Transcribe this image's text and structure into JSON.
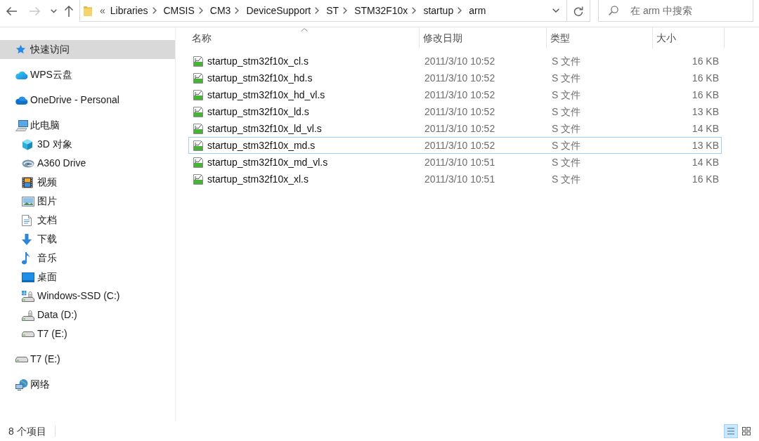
{
  "toolbar": {
    "nav_buttons": [
      {
        "kind": "back",
        "disabled": false
      },
      {
        "kind": "forward",
        "disabled": true
      },
      {
        "kind": "recent",
        "disabled": false
      },
      {
        "kind": "up",
        "disabled": false
      }
    ],
    "address": {
      "overflow": "«",
      "path": [
        "Libraries",
        "CMSIS",
        "CM3",
        "DeviceSupport",
        "ST",
        "STM32F10x",
        "startup",
        "arm"
      ]
    },
    "search": {
      "placeholder": "在 arm 中搜索"
    }
  },
  "sidebar": {
    "items": [
      {
        "label": "快速访问",
        "kind": "quickaccess",
        "selected": true
      },
      {
        "label": "WPS云盘",
        "kind": "wpscloud",
        "selected": false
      },
      {
        "label": "OneDrive - Personal",
        "kind": "onedrive",
        "selected": false
      },
      {
        "label": "此电脑",
        "kind": "computer",
        "selected": false,
        "children": [
          {
            "label": "3D 对象",
            "kind": "objects3d",
            "selected": false
          },
          {
            "label": "A360 Drive",
            "kind": "a360",
            "selected": false
          },
          {
            "label": "视频",
            "kind": "videos",
            "selected": false
          },
          {
            "label": "图片",
            "kind": "pictures",
            "selected": false
          },
          {
            "label": "文档",
            "kind": "documents",
            "selected": false
          },
          {
            "label": "下载",
            "kind": "downloads",
            "selected": false
          },
          {
            "label": "音乐",
            "kind": "music",
            "selected": false
          },
          {
            "label": "桌面",
            "kind": "desktop",
            "selected": false
          },
          {
            "label": "Windows-SSD (C:)",
            "kind": "sysdrive",
            "selected": false
          },
          {
            "label": "Data (D:)",
            "kind": "datadrive",
            "selected": false
          },
          {
            "label": "T7 (E:)",
            "kind": "usbdrive",
            "selected": false
          }
        ]
      },
      {
        "label": "T7 (E:)",
        "kind": "usbdrive",
        "selected": false
      },
      {
        "label": "网络",
        "kind": "network",
        "selected": false
      }
    ]
  },
  "file_list": {
    "columns": [
      {
        "label": "名称",
        "sorted": true
      },
      {
        "label": "修改日期",
        "sorted": false
      },
      {
        "label": "类型",
        "sorted": false
      },
      {
        "label": "大小",
        "sorted": false
      }
    ],
    "rows": [
      {
        "name": "startup_stm32f10x_cl.s",
        "modified": "2011/3/10 10:52",
        "type": "S 文件",
        "size": "16 KB",
        "focused": false
      },
      {
        "name": "startup_stm32f10x_hd.s",
        "modified": "2011/3/10 10:52",
        "type": "S 文件",
        "size": "16 KB",
        "focused": false
      },
      {
        "name": "startup_stm32f10x_hd_vl.s",
        "modified": "2011/3/10 10:52",
        "type": "S 文件",
        "size": "16 KB",
        "focused": false
      },
      {
        "name": "startup_stm32f10x_ld.s",
        "modified": "2011/3/10 10:52",
        "type": "S 文件",
        "size": "13 KB",
        "focused": false
      },
      {
        "name": "startup_stm32f10x_ld_vl.s",
        "modified": "2011/3/10 10:52",
        "type": "S 文件",
        "size": "14 KB",
        "focused": false
      },
      {
        "name": "startup_stm32f10x_md.s",
        "modified": "2011/3/10 10:52",
        "type": "S 文件",
        "size": "13 KB",
        "focused": true
      },
      {
        "name": "startup_stm32f10x_md_vl.s",
        "modified": "2011/3/10 10:51",
        "type": "S 文件",
        "size": "14 KB",
        "focused": false
      },
      {
        "name": "startup_stm32f10x_xl.s",
        "modified": "2011/3/10 10:51",
        "type": "S 文件",
        "size": "16 KB",
        "focused": false
      }
    ]
  },
  "status_bar": {
    "item_count": "8 个项目",
    "view_buttons": [
      {
        "kind": "details",
        "selected": true
      },
      {
        "kind": "tiles",
        "selected": false
      }
    ]
  }
}
